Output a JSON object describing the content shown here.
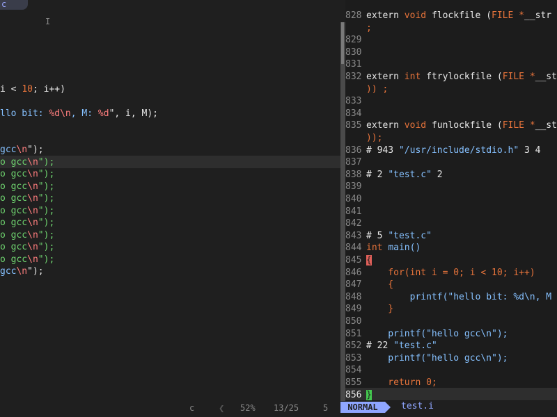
{
  "left": {
    "tab_label": "c",
    "cursor_char": "I",
    "lines": [
      {
        "parts": [
          {
            "t": "i < ",
            "c": "plain"
          },
          {
            "t": "10",
            "c": "numc"
          },
          {
            "t": "; i++)",
            "c": "plain"
          }
        ]
      },
      {
        "parts": [
          {
            "t": "llo bit: ",
            "c": "str2"
          },
          {
            "t": "%d\\n",
            "c": "fmt"
          },
          {
            "t": ", M: ",
            "c": "str2"
          },
          {
            "t": "%d",
            "c": "fmt"
          },
          {
            "t": "\", i, M);",
            "c": "plain"
          }
        ]
      },
      {
        "parts": [
          {
            "t": "gcc",
            "c": "str2"
          },
          {
            "t": "\\n",
            "c": "fmt"
          },
          {
            "t": "\");",
            "c": "plain"
          }
        ]
      },
      {
        "parts": [
          {
            "t": "o gcc",
            "c": "green"
          },
          {
            "t": "\\n",
            "c": "fmt"
          },
          {
            "t": "\");",
            "c": "green"
          }
        ]
      },
      {
        "parts": [
          {
            "t": "o gcc",
            "c": "green"
          },
          {
            "t": "\\n",
            "c": "fmt"
          },
          {
            "t": "\");",
            "c": "green"
          }
        ]
      },
      {
        "parts": [
          {
            "t": "o gcc",
            "c": "green"
          },
          {
            "t": "\\n",
            "c": "fmt"
          },
          {
            "t": "\");",
            "c": "green"
          }
        ]
      },
      {
        "parts": [
          {
            "t": "o gcc",
            "c": "green"
          },
          {
            "t": "\\n",
            "c": "fmt"
          },
          {
            "t": "\");",
            "c": "green"
          }
        ]
      },
      {
        "parts": [
          {
            "t": "o gcc",
            "c": "green"
          },
          {
            "t": "\\n",
            "c": "fmt"
          },
          {
            "t": "\");",
            "c": "green"
          }
        ]
      },
      {
        "parts": [
          {
            "t": "o gcc",
            "c": "green"
          },
          {
            "t": "\\n",
            "c": "fmt"
          },
          {
            "t": "\");",
            "c": "green"
          }
        ]
      },
      {
        "parts": [
          {
            "t": "o gcc",
            "c": "green"
          },
          {
            "t": "\\n",
            "c": "fmt"
          },
          {
            "t": "\");",
            "c": "green"
          }
        ]
      },
      {
        "parts": [
          {
            "t": "o gcc",
            "c": "green"
          },
          {
            "t": "\\n",
            "c": "fmt"
          },
          {
            "t": "\");",
            "c": "green"
          }
        ]
      },
      {
        "parts": [
          {
            "t": "o gcc",
            "c": "green"
          },
          {
            "t": "\\n",
            "c": "fmt"
          },
          {
            "t": "\");",
            "c": "green"
          }
        ]
      },
      {
        "parts": [
          {
            "t": "gcc",
            "c": "str2"
          },
          {
            "t": "\\n",
            "c": "fmt"
          },
          {
            "t": "\");",
            "c": "plain"
          }
        ]
      }
    ],
    "status": {
      "filetype": "c",
      "percent": "52%",
      "position": "13/25",
      "col": "5"
    }
  },
  "right": {
    "lines": [
      {
        "n": "828",
        "parts": [
          {
            "t": "extern ",
            "c": "plain"
          },
          {
            "t": "void ",
            "c": "kw"
          },
          {
            "t": "flockfile (",
            "c": "plain"
          },
          {
            "t": "FILE *",
            "c": "kw"
          },
          {
            "t": "__str",
            "c": "plain"
          }
        ]
      },
      {
        "n": "",
        "parts": [
          {
            "t": ";",
            "c": "kw"
          }
        ]
      },
      {
        "n": "829",
        "parts": []
      },
      {
        "n": "830",
        "parts": []
      },
      {
        "n": "831",
        "parts": []
      },
      {
        "n": "832",
        "parts": [
          {
            "t": "extern ",
            "c": "plain"
          },
          {
            "t": "int ",
            "c": "kw"
          },
          {
            "t": "ftrylockfile (",
            "c": "plain"
          },
          {
            "t": "FILE *",
            "c": "kw"
          },
          {
            "t": "__st",
            "c": "plain"
          }
        ]
      },
      {
        "n": "",
        "parts": [
          {
            "t": ")) ;",
            "c": "kw"
          }
        ]
      },
      {
        "n": "833",
        "parts": []
      },
      {
        "n": "834",
        "parts": []
      },
      {
        "n": "835",
        "parts": [
          {
            "t": "extern ",
            "c": "plain"
          },
          {
            "t": "void ",
            "c": "kw"
          },
          {
            "t": "funlockfile (",
            "c": "plain"
          },
          {
            "t": "FILE *",
            "c": "kw"
          },
          {
            "t": "__st",
            "c": "plain"
          }
        ]
      },
      {
        "n": "",
        "parts": [
          {
            "t": "));",
            "c": "kw"
          }
        ]
      },
      {
        "n": "836",
        "parts": [
          {
            "t": "# 943 ",
            "c": "plain"
          },
          {
            "t": "\"/usr/include/stdio.h\"",
            "c": "str2"
          },
          {
            "t": " 3 4",
            "c": "plain"
          }
        ]
      },
      {
        "n": "837",
        "parts": []
      },
      {
        "n": "838",
        "parts": [
          {
            "t": "# 2 ",
            "c": "plain"
          },
          {
            "t": "\"test.c\"",
            "c": "str2"
          },
          {
            "t": " 2",
            "c": "plain"
          }
        ]
      },
      {
        "n": "839",
        "parts": []
      },
      {
        "n": "840",
        "parts": []
      },
      {
        "n": "841",
        "parts": []
      },
      {
        "n": "842",
        "parts": []
      },
      {
        "n": "843",
        "parts": [
          {
            "t": "# 5 ",
            "c": "plain"
          },
          {
            "t": "\"test.c\"",
            "c": "str2"
          }
        ]
      },
      {
        "n": "844",
        "parts": [
          {
            "t": "int ",
            "c": "kw"
          },
          {
            "t": "main()",
            "c": "str2"
          }
        ]
      },
      {
        "n": "845",
        "parts": [
          {
            "t": "{",
            "c": "bracket"
          }
        ]
      },
      {
        "n": "846",
        "parts": [
          {
            "t": "    for(",
            "c": "kw"
          },
          {
            "t": "int ",
            "c": "kw"
          },
          {
            "t": "i = ",
            "c": "kw"
          },
          {
            "t": "0",
            "c": "numc"
          },
          {
            "t": "; i < ",
            "c": "kw"
          },
          {
            "t": "10",
            "c": "numc"
          },
          {
            "t": "; i++)",
            "c": "kw"
          }
        ]
      },
      {
        "n": "847",
        "parts": [
          {
            "t": "    {",
            "c": "kw"
          }
        ]
      },
      {
        "n": "848",
        "parts": [
          {
            "t": "        printf(",
            "c": "str2"
          },
          {
            "t": "\"hello bit: %d\\n, M",
            "c": "str2"
          }
        ]
      },
      {
        "n": "849",
        "parts": [
          {
            "t": "    }",
            "c": "kw"
          }
        ]
      },
      {
        "n": "850",
        "parts": []
      },
      {
        "n": "851",
        "parts": [
          {
            "t": "    printf(",
            "c": "str2"
          },
          {
            "t": "\"hello gcc\\n\");",
            "c": "str2"
          }
        ]
      },
      {
        "n": "852",
        "parts": [
          {
            "t": "# 22 ",
            "c": "plain"
          },
          {
            "t": "\"test.c\"",
            "c": "str2"
          }
        ]
      },
      {
        "n": "853",
        "parts": [
          {
            "t": "    printf(",
            "c": "str2"
          },
          {
            "t": "\"hello gcc\\n\");",
            "c": "str2"
          }
        ]
      },
      {
        "n": "854",
        "parts": []
      },
      {
        "n": "855",
        "parts": [
          {
            "t": "    return ",
            "c": "kw"
          },
          {
            "t": "0",
            "c": "numc"
          },
          {
            "t": ";",
            "c": "kw"
          }
        ]
      },
      {
        "n": "856",
        "parts": [
          {
            "t": "}",
            "c": "bracket-g"
          }
        ],
        "current": true
      }
    ],
    "status": {
      "mode": "NORMAL",
      "filename": "test.i"
    }
  }
}
